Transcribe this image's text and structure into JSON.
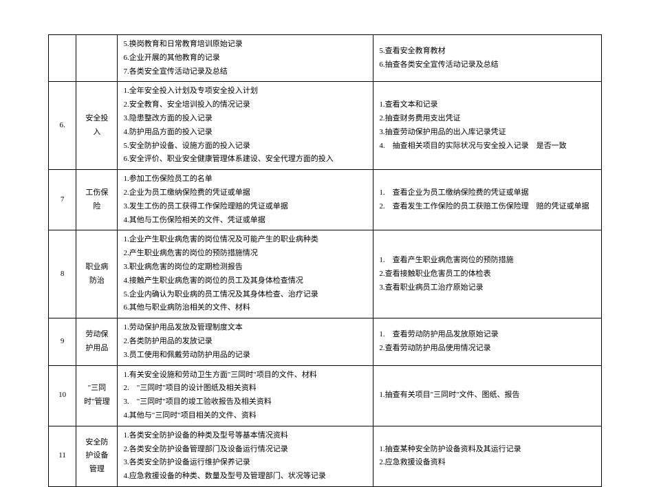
{
  "rows": [
    {
      "num": "",
      "name": "",
      "left": [
        "5.换岗教育和日常教育培训原始记录",
        "6.企业开展的其他教育的记录",
        "7.各类安全宣传活动记录及总结"
      ],
      "right": [
        "5.查看安全教育教材",
        "6.抽查各类安全宣传活动记录及总结"
      ]
    },
    {
      "num": "6.",
      "name": "安全投入",
      "left": [
        "1.全年安全投入计划及专项安全投入计划",
        "2.安全教育、安全培训投入的情况记录",
        "3.隐患整改方面的投入记录",
        "4.防护用品方面的投入记录",
        "5.安全防护设备、设施方面的投入记录",
        "6.安全评价、职业安全健康管理体系建设、安全代理方面的投入"
      ],
      "right": [
        "1.查看文本和记录",
        "2.抽查财务费用支出凭证",
        "3.抽查劳动保护用品的出入库记录凭证",
        "4.　抽查相关项目的实际状况与安全投入记录　是否一致"
      ]
    },
    {
      "num": "7",
      "name": "工伤保险",
      "left": [
        "1.参加工伤保险员工的名单",
        "2.企业为员工缴纳保险费的凭证或单据",
        "3.发生工伤的员工获得工作保险理赔的凭证或单据",
        "4.其他与工伤保险相关的文件、凭证或单据"
      ],
      "right": [
        "1.　查看企业为员工缴纳保险费的凭证或单据",
        "2.　查看发生工作保险的员工获赔工伤保险理　赔的凭证或单据"
      ]
    },
    {
      "num": "8",
      "name": "职业病防治",
      "left": [
        "1.企业产生职业病危害的岗位情况及可能产生的职业病种类",
        "2.产生职业病危害的岗位的预防措施情况",
        "3.职业病危害的岗位的定期检测报告",
        "4.接触产生职业病危害的岗位的员工及其身体检查情况",
        "5.企业内确认为职业病的员工情况及其身体检查、治疗记录",
        "6.其他与职业病防治相关的文件、材料"
      ],
      "right": [
        "1.　查看产生职业病危害岗位的预防措施",
        "2.查看接触职业危害员工的体检表",
        "3.查看职业病员工治疗原始记录"
      ]
    },
    {
      "num": "9",
      "name": "劳动保护用品",
      "left": [
        "1.劳动保护用品发放及管理制度文本",
        "2.各类防护用品的发放记录",
        "3.员工使用和佩戴劳动防护用品的记录"
      ],
      "right": [
        "1.　查看劳动防护用品发放原始记录",
        "2.查看劳动防护用品使用情况记录"
      ]
    },
    {
      "num": "10",
      "name": "\"三同 时\"管理",
      "left": [
        "1.有关安全设施和劳动卫生方面\"三同时\"项目的文件、材料",
        "2.　\"三同时\"项目的设计图纸及相关资料",
        "3.　\"三同时\"项目的竣工验收报告及相关资料",
        "4.其他与\"三同时\"项目相关的文件、资料"
      ],
      "right": [
        "1.抽查有关项目\"三同时\"文件、图纸、报告"
      ]
    },
    {
      "num": "11",
      "name": "安全防护设备管理",
      "left": [
        "1.各类安全防护设备的种类及型号等基本情况资料",
        "2.各类安全防护设备管理部门及设备运行情况记录",
        "3.各类安全防护设备运行维护保养记录",
        "4.应急救援设备的种类、数量及型号及管理部门、状况等记录"
      ],
      "right": [
        "1.抽查某种安全防护设备资料及其运行记录",
        "2.应急救援设备资料"
      ]
    }
  ]
}
